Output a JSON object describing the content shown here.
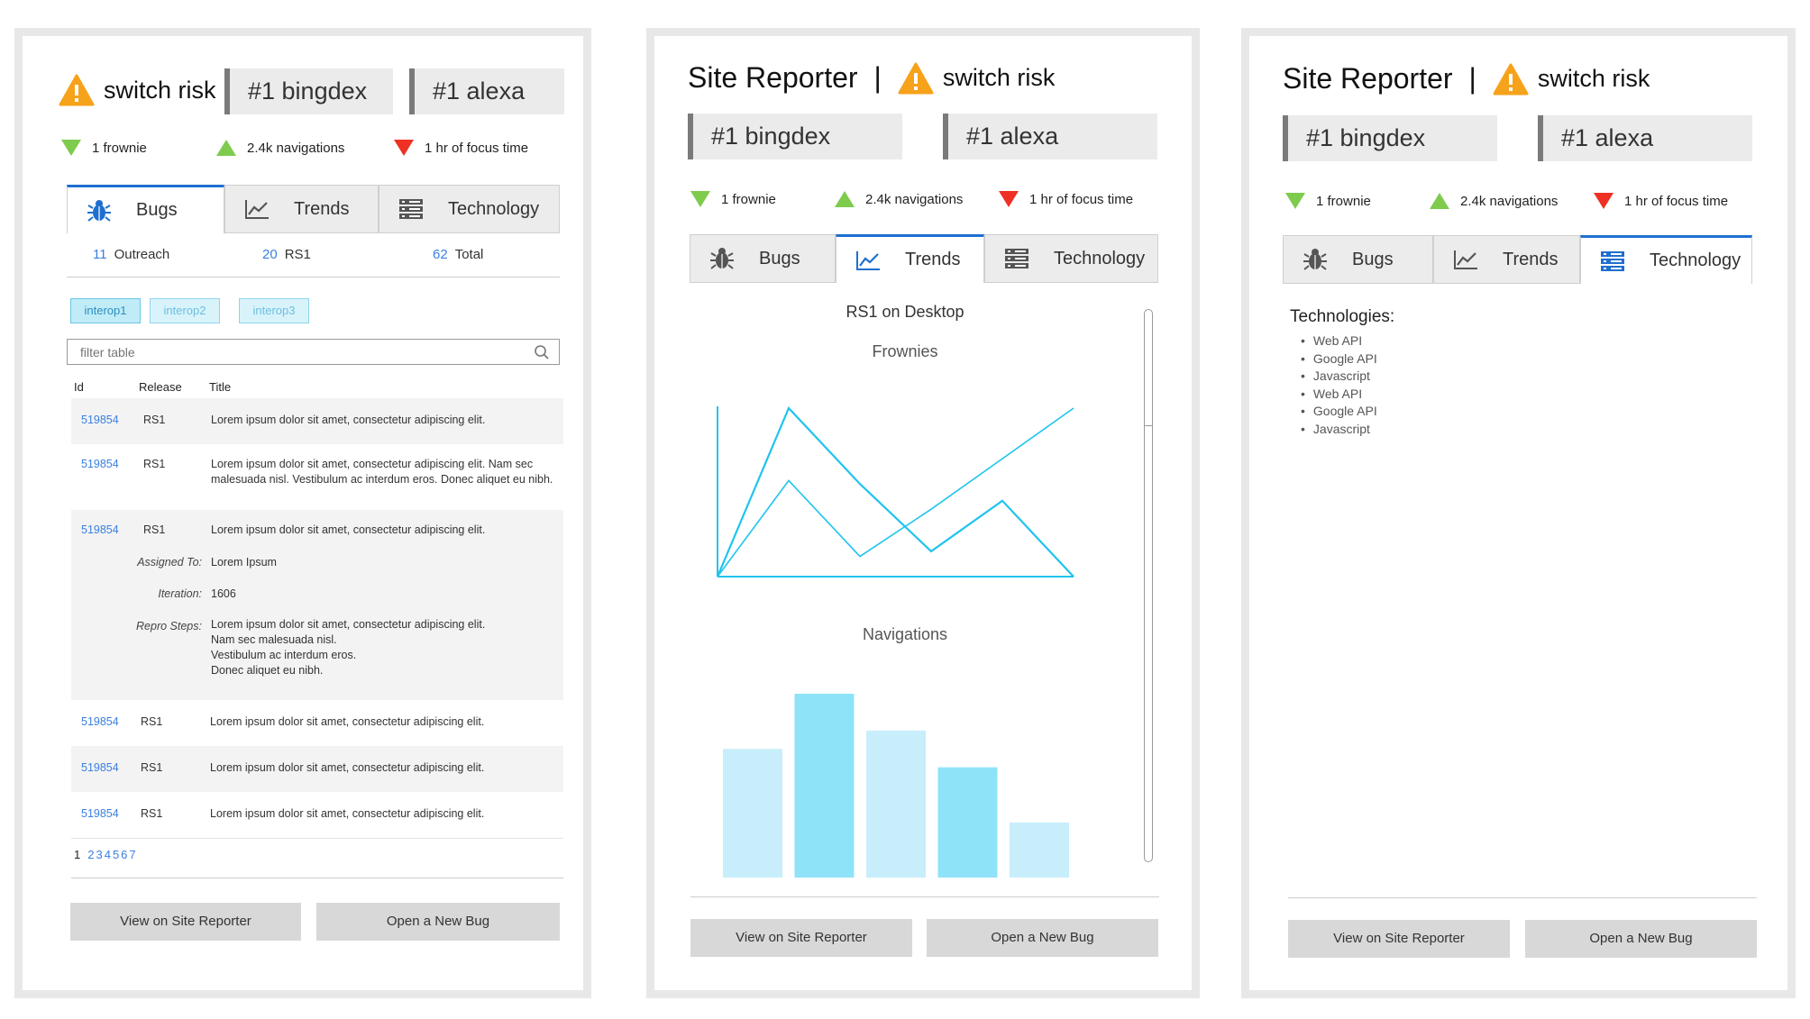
{
  "app": {
    "title": "Site Reporter",
    "separator": "|",
    "risk_label": "switch risk"
  },
  "ranks": {
    "bingdex": "#1 bingdex",
    "alexa": "#1 alexa"
  },
  "stats": {
    "frownie": "1 frownie",
    "navigations": "2.4k navigations",
    "focus": "1 hr of focus time"
  },
  "tabs": {
    "bugs": "Bugs",
    "trends": "Trends",
    "technology": "Technology"
  },
  "bugs_view": {
    "counts": [
      {
        "num": "11",
        "label": "Outreach"
      },
      {
        "num": "20",
        "label": "RS1"
      },
      {
        "num": "62",
        "label": "Total"
      }
    ],
    "chips": [
      "interop1",
      "interop2",
      "interop3"
    ],
    "search_placeholder": "filter table",
    "columns": {
      "id": "Id",
      "release": "Release",
      "title": "Title"
    },
    "rows": [
      {
        "id": "519854",
        "release": "RS1",
        "title": "Lorem ipsum dolor sit amet, consectetur adipiscing elit."
      },
      {
        "id": "519854",
        "release": "RS1",
        "title": "Lorem ipsum dolor sit amet, consectetur adipiscing elit. Nam sec malesuada nisl. Vestibulum ac interdum eros. Donec aliquet eu nibh."
      },
      {
        "id": "519854",
        "release": "RS1",
        "title": "Lorem ipsum dolor sit amet, consectetur adipiscing elit."
      },
      {
        "id": "519854",
        "release": "RS1",
        "title": "Lorem ipsum dolor sit amet, consectetur adipiscing elit."
      },
      {
        "id": "519854",
        "release": "RS1",
        "title": "Lorem ipsum dolor sit amet, consectetur adipiscing elit."
      },
      {
        "id": "519854",
        "release": "RS1",
        "title": "Lorem ipsum dolor sit amet, consectetur adipiscing elit."
      }
    ],
    "details": {
      "assigned_label": "Assigned To:",
      "assigned_value": "Lorem Ipsum",
      "iteration_label": "Iteration:",
      "iteration_value": "1606",
      "repro_label": "Repro Steps:",
      "repro_lines": [
        "Lorem ipsum dolor sit amet, consectetur adipiscing elit.",
        "Nam sec malesuada nisl.",
        "Vestibulum ac interdum eros.",
        "Donec aliquet eu nibh."
      ]
    },
    "pagination": {
      "current": "1",
      "pages": [
        "2",
        "3",
        "4",
        "5",
        "6",
        "7"
      ]
    }
  },
  "trends_view": {
    "heading": "RS1 on Desktop",
    "frownies_title": "Frownies",
    "navigations_title": "Navigations"
  },
  "chart_data": [
    {
      "type": "line",
      "title": "Frownies",
      "x": [
        0,
        1,
        2,
        3,
        4,
        5
      ],
      "series": [
        {
          "values": [
            0,
            100,
            55,
            15,
            45,
            0
          ]
        },
        {
          "values": [
            0,
            57,
            12,
            40,
            70,
            100
          ]
        }
      ],
      "ylim": [
        0,
        100
      ],
      "color": "#1fc4ee"
    },
    {
      "type": "bar",
      "title": "Navigations",
      "categories": [
        "1",
        "2",
        "3",
        "4",
        "5"
      ],
      "values": [
        70,
        100,
        80,
        60,
        30
      ],
      "ylim": [
        0,
        100
      ],
      "colors": [
        "#c8eefb",
        "#8ee3f8",
        "#c8eefb",
        "#8ee3f8",
        "#c8eefb"
      ]
    }
  ],
  "tech_view": {
    "title": "Technologies:",
    "items": [
      "Web API",
      "Google API",
      "Javascript",
      "Web API",
      "Google API",
      "Javascript"
    ]
  },
  "buttons": {
    "view": "View on Site Reporter",
    "open_bug": "Open a New Bug"
  },
  "colors": {
    "accent": "#1f6fd0",
    "link": "#3b7fe0",
    "chart": "#1fc4ee",
    "up": "#7ecb4e",
    "down_red": "#ee3124",
    "warning": "#f7a21b"
  }
}
